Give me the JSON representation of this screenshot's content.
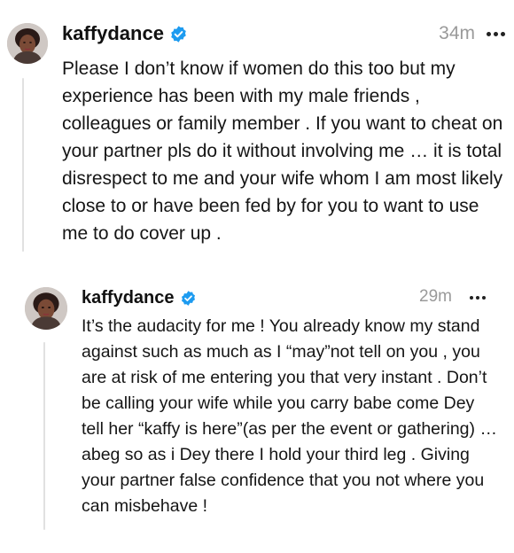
{
  "posts": [
    {
      "username": "kaffydance",
      "timestamp": "34m",
      "text": "Please I don’t know if women do this too but my experience has been with my male friends , colleagues or family member . If you want to cheat on your partner pls do it without involving me … it is total disrespect to me and your wife whom I am most likely close to or have been fed by for you to want to use me to do cover up ."
    },
    {
      "username": "kaffydance",
      "timestamp": "29m",
      "text": "It’s the audacity for me ! You already know my stand against such as much as I “may”not tell on you , you are at risk of me entering you that very instant . Don’t be calling your wife while you carry babe come Dey tell her “kaffy is here”(as per the event or gathering) …abeg so as i Dey there I hold your third leg . Giving your partner false confidence that you not where you can misbehave !"
    }
  ],
  "icons": {
    "verified": "verified-badge-icon",
    "more": "more-options-icon"
  },
  "colors": {
    "verified": "#1d9bf0",
    "timestamp": "#9a9a9a",
    "thread_line": "#e1e1e1",
    "text": "#151515"
  }
}
